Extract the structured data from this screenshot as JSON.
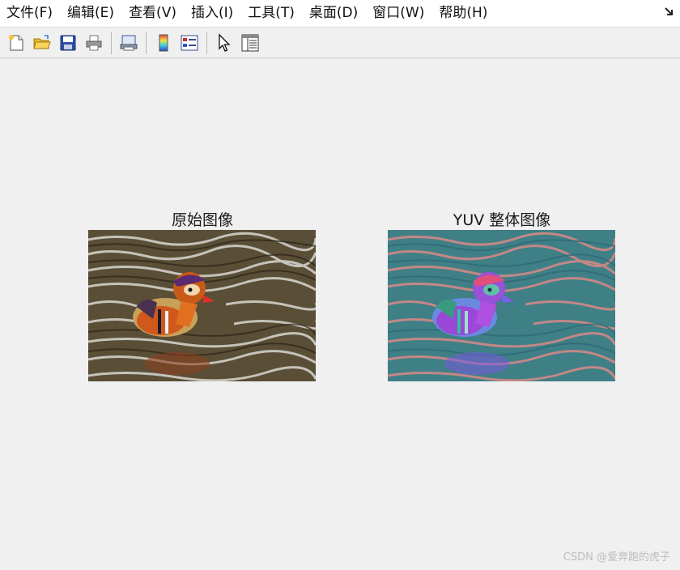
{
  "menu": {
    "items": [
      {
        "name": "menu-file",
        "label": "文件(F)"
      },
      {
        "name": "menu-edit",
        "label": "编辑(E)"
      },
      {
        "name": "menu-view",
        "label": "查看(V)"
      },
      {
        "name": "menu-insert",
        "label": "插入(I)"
      },
      {
        "name": "menu-tools",
        "label": "工具(T)"
      },
      {
        "name": "menu-desktop",
        "label": "桌面(D)"
      },
      {
        "name": "menu-window",
        "label": "窗口(W)"
      },
      {
        "name": "menu-help",
        "label": "帮助(H)"
      }
    ]
  },
  "toolbar": {
    "icons": [
      "new-figure-icon",
      "open-file-icon",
      "save-icon",
      "print-icon",
      "print-preview-icon",
      "colorbar-icon",
      "legend-icon",
      "pointer-icon",
      "property-editor-icon"
    ]
  },
  "figure": {
    "left_title": "原始图像",
    "right_title": "YUV 整体图像"
  },
  "colors": {
    "left_water_dark": "#3d3520",
    "left_water_light": "#d8d8d2",
    "duck_orange": "#d0581c",
    "right_water_teal": "#3f7f86",
    "right_water_pink": "#d98a87",
    "duck_purple": "#9a48d8"
  },
  "watermark": "CSDN @爱奔跑的虎子"
}
